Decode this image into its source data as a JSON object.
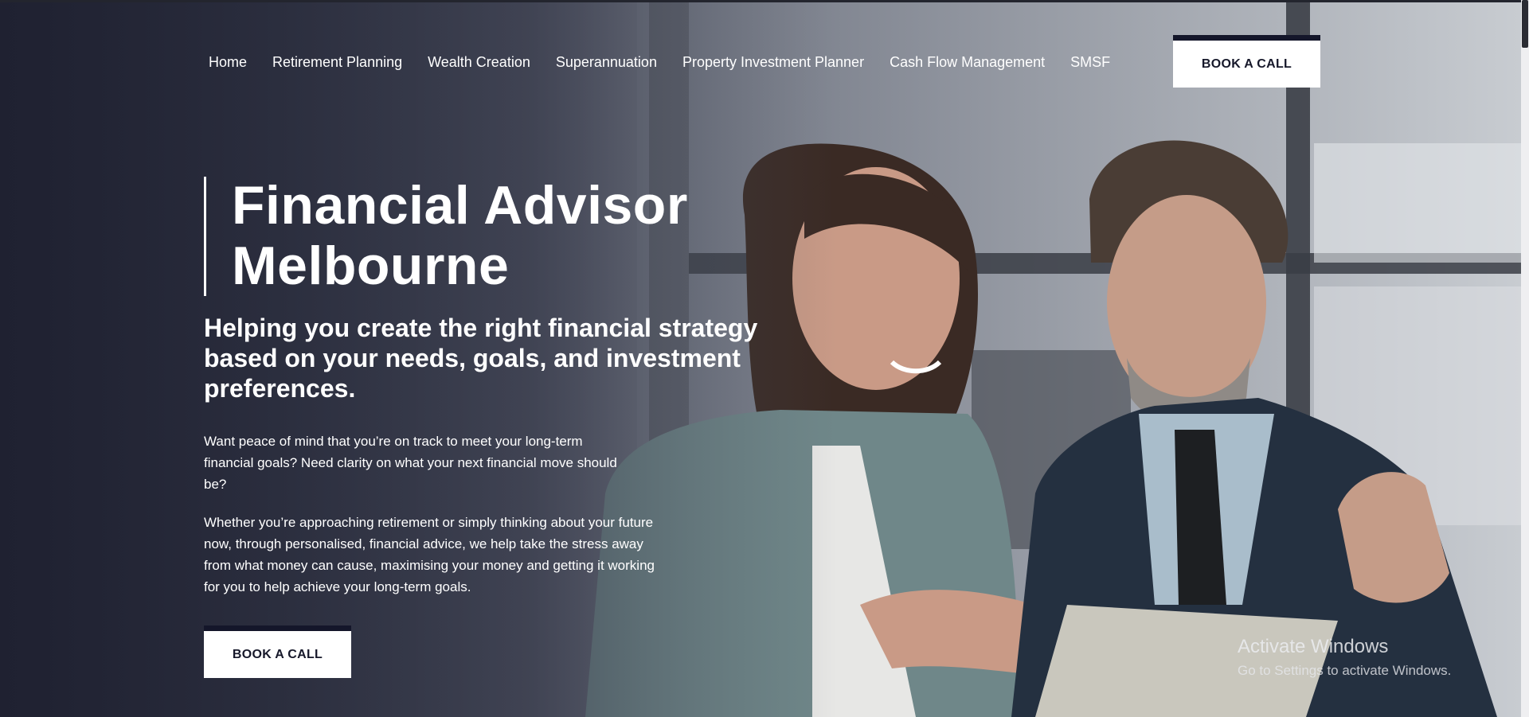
{
  "nav": {
    "items": [
      {
        "label": "Home"
      },
      {
        "label": "Retirement Planning"
      },
      {
        "label": "Wealth Creation"
      },
      {
        "label": "Superannuation"
      },
      {
        "label": "Property Investment Planner"
      },
      {
        "label": "Cash Flow Management"
      },
      {
        "label": "SMSF"
      }
    ],
    "cta_label": "BOOK A CALL"
  },
  "hero": {
    "title_line1": "Financial Advisor",
    "title_line2": "Melbourne",
    "subtitle": "Helping you create the right financial strategy based on your needs, goals, and investment preferences.",
    "paragraph1": "Want peace of mind that you’re on track to meet your long-term financial goals? Need clarity on what your next financial move should be?",
    "paragraph2": "Whether you’re approaching retirement or simply thinking about your future now, through personalised, financial advice, we help take the stress away from what money can cause, maximising your money and getting it working for you to help achieve your long-term goals.",
    "cta_label": "BOOK A CALL"
  },
  "watermark": {
    "title": "Activate Windows",
    "subtitle": "Go to Settings to activate Windows."
  },
  "colors": {
    "brand_dark": "#14162a",
    "text_light": "#ffffff",
    "button_bg": "#ffffff"
  }
}
